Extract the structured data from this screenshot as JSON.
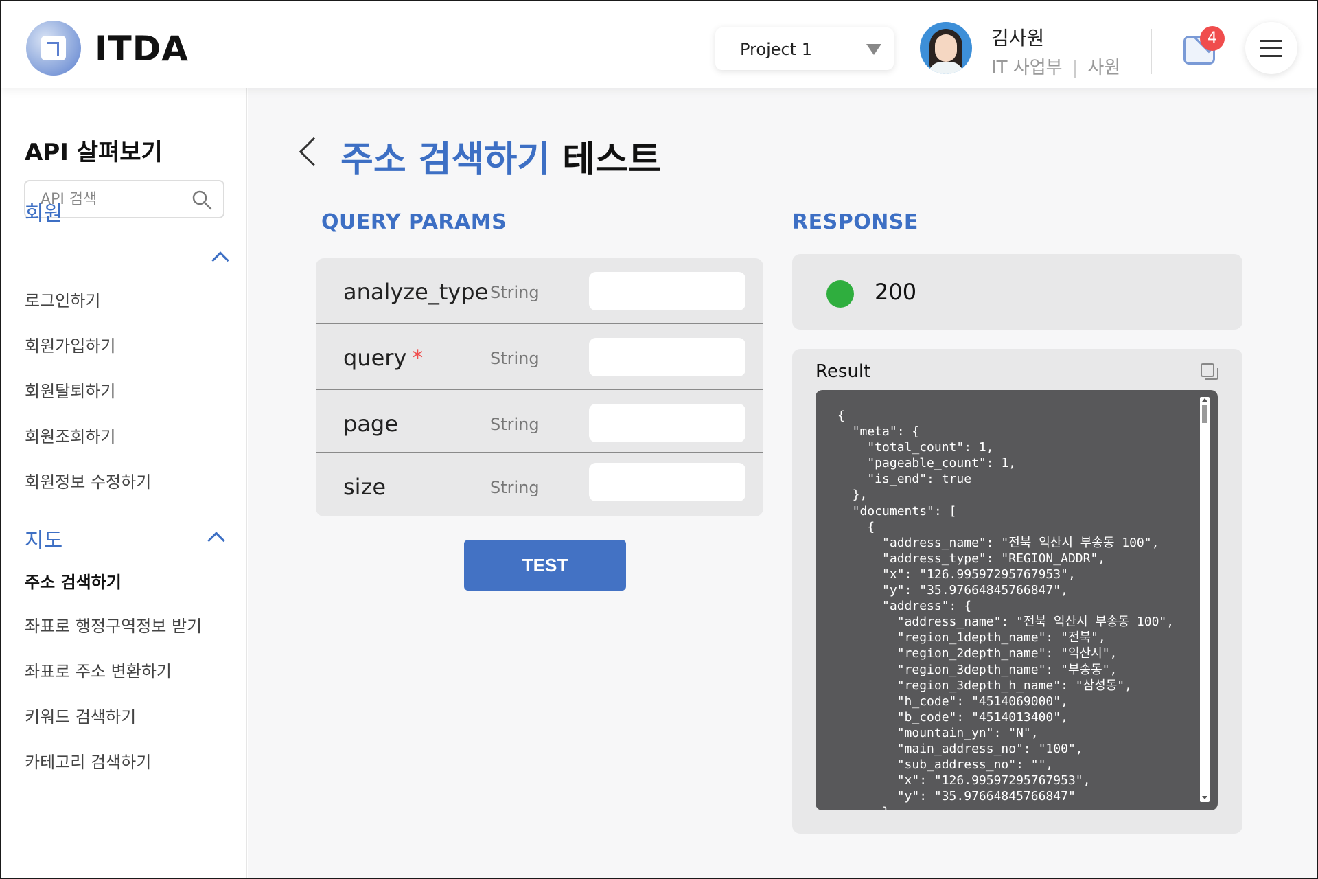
{
  "header": {
    "logo_text": "ITDA",
    "project": {
      "selected": "Project 1"
    },
    "user": {
      "name": "김사원",
      "department": "IT 사업부",
      "separator": "|",
      "position": "사원"
    },
    "notifications": {
      "count": "4"
    },
    "icons": [
      "logo-icon",
      "caret-down-icon",
      "avatar-icon",
      "mail-icon",
      "hamburger-menu-icon"
    ]
  },
  "sidebar": {
    "title": "API 살펴보기",
    "search": {
      "placeholder": "API 검색",
      "value": ""
    },
    "sections": [
      {
        "label": "회원",
        "expanded": true,
        "items": [
          {
            "label": "로그인하기"
          },
          {
            "label": "회원가입하기"
          },
          {
            "label": "회원탈퇴하기"
          },
          {
            "label": "회원조회하기"
          },
          {
            "label": "회원정보 수정하기"
          }
        ]
      },
      {
        "label": "지도",
        "expanded": true,
        "items": [
          {
            "label": "주소 검색하기",
            "active": true
          },
          {
            "label": "좌표로 행정구역정보 받기"
          },
          {
            "label": "좌표로 주소 변환하기"
          },
          {
            "label": "키워드 검색하기"
          },
          {
            "label": "카테고리 검색하기"
          }
        ]
      }
    ]
  },
  "main": {
    "title_highlight": "주소 검색하기",
    "title_rest": "테스트",
    "query_params_label": "QUERY PARAMS",
    "params": [
      {
        "name": "analyze_type",
        "required": false,
        "type": "String",
        "value": ""
      },
      {
        "name": "query",
        "required": true,
        "required_mark": "*",
        "type": "String",
        "value": ""
      },
      {
        "name": "page",
        "required": false,
        "type": "String",
        "value": ""
      },
      {
        "name": "size",
        "required": false,
        "type": "String",
        "value": ""
      }
    ],
    "test_button": "TEST",
    "response_label": "RESPONSE",
    "status": {
      "code": "200",
      "color": "#2fae3e"
    },
    "result": {
      "label": "Result",
      "code": "{\n  \"meta\": {\n    \"total_count\": 1,\n    \"pageable_count\": 1,\n    \"is_end\": true\n  },\n  \"documents\": [\n    {\n      \"address_name\": \"전북 익산시 부송동 100\",\n      \"address_type\": \"REGION_ADDR\",\n      \"x\": \"126.99597295767953\",\n      \"y\": \"35.97664845766847\",\n      \"address\": {\n        \"address_name\": \"전북 익산시 부송동 100\",\n        \"region_1depth_name\": \"전북\",\n        \"region_2depth_name\": \"익산시\",\n        \"region_3depth_name\": \"부송동\",\n        \"region_3depth_h_name\": \"삼성동\",\n        \"h_code\": \"4514069000\",\n        \"b_code\": \"4514013400\",\n        \"mountain_yn\": \"N\",\n        \"main_address_no\": \"100\",\n        \"sub_address_no\": \"\",\n        \"x\": \"126.99597295767953\",\n        \"y\": \"35.97664845766847\"\n      },"
    }
  },
  "colors": {
    "accent": "#3d6fc4",
    "button": "#4372c4",
    "badge": "#f04d4d",
    "required": "#f04d4d",
    "code_bg": "#58585a",
    "panel_bg": "#e8e8e9"
  }
}
